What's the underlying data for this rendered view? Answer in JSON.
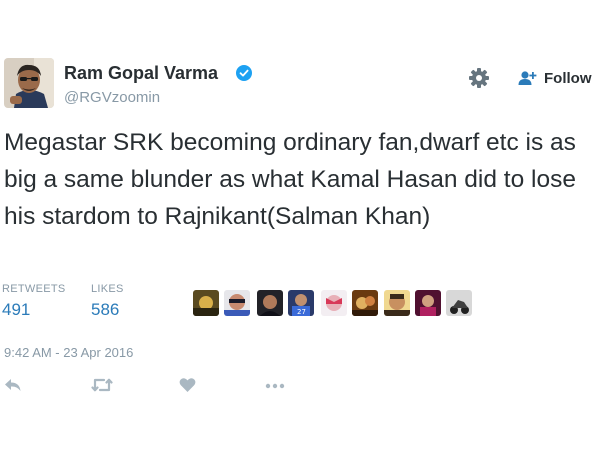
{
  "author": {
    "name": "Ram Gopal Varma",
    "handle": "@RGVzoomin"
  },
  "follow_label": "Follow",
  "tweet_text": "Megastar SRK becoming ordinary fan,dwarf etc is as big a same blunder as what Kamal Hasan did to lose his stardom to Rajnikant(Salman Khan)",
  "stats": {
    "retweets_label": "RETWEETS",
    "retweets_value": "491",
    "likes_label": "LIKES",
    "likes_value": "586"
  },
  "timestamp": "9:42 AM - 23 Apr 2016",
  "icons": {
    "verified": "verified-badge-icon",
    "settings": "gear-icon",
    "follow": "add-user-icon",
    "reply": "reply-icon",
    "retweet": "retweet-icon",
    "like": "heart-icon",
    "more": "more-icon"
  },
  "colors": {
    "text": "#292f33",
    "muted": "#8899a6",
    "link_blue": "#2b7bb9",
    "verified_blue": "#1da1f2",
    "action_gray": "#aab8c2"
  }
}
